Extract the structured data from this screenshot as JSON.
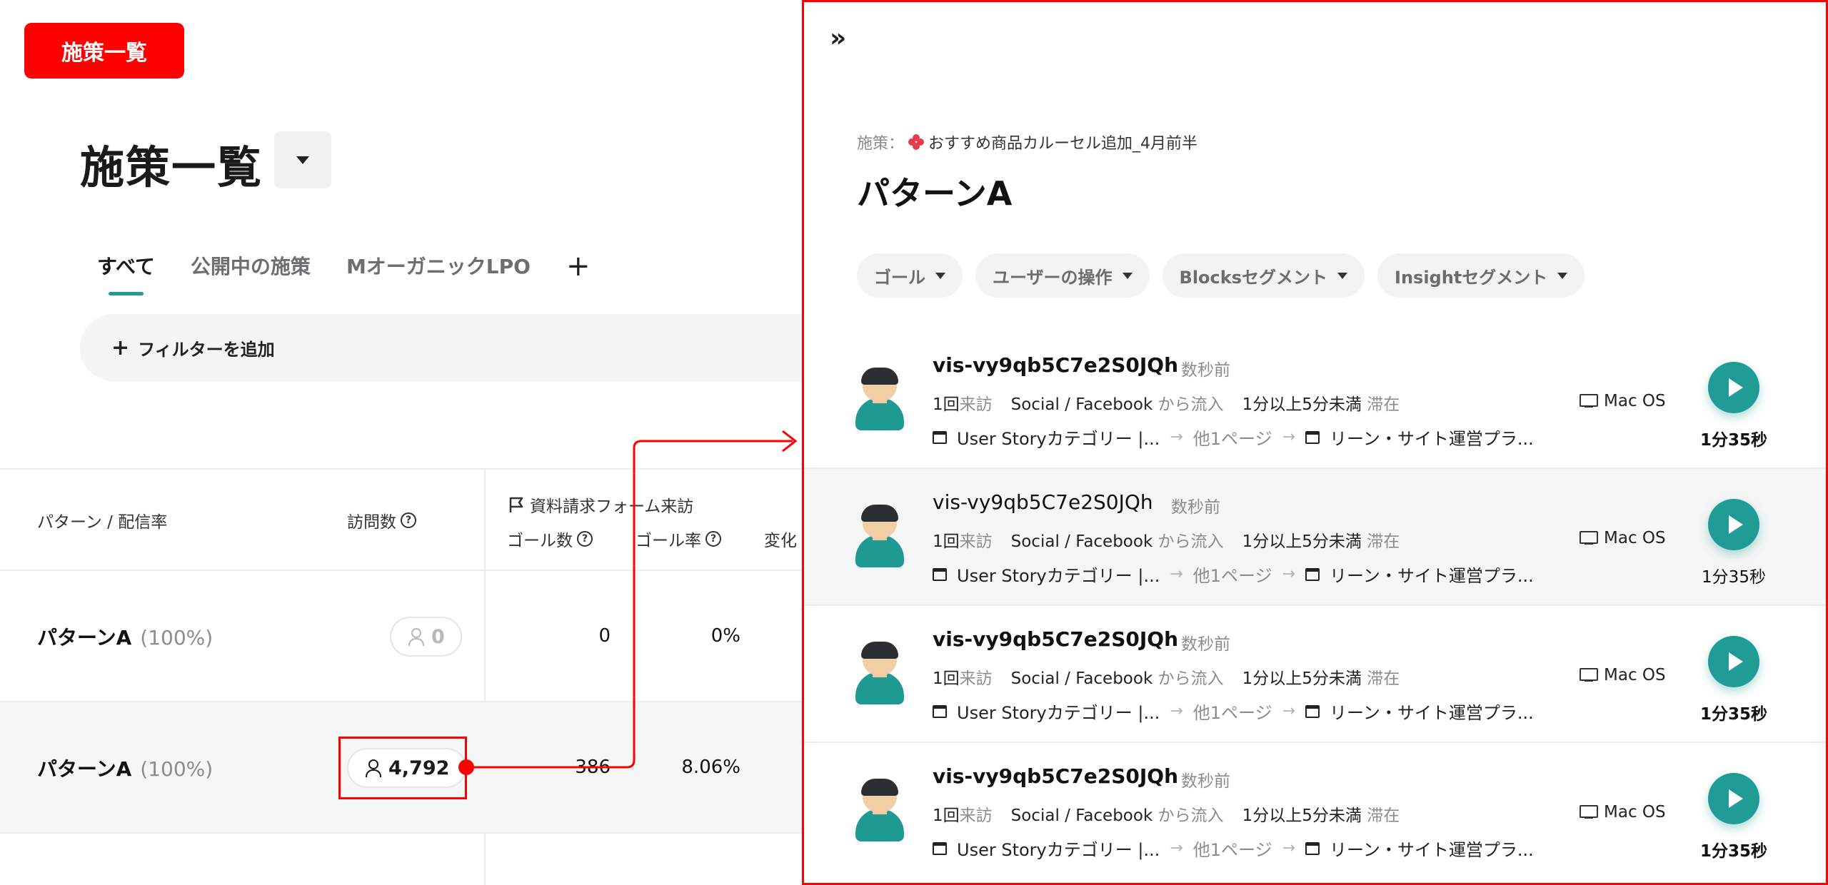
{
  "badge": "施策一覧",
  "page": {
    "title": "施策一覧"
  },
  "tabs": [
    "すべて",
    "公開中の施策",
    "MオーガニックLPO",
    "+"
  ],
  "filter": {
    "plus": "+",
    "label": "フィルターを追加"
  },
  "table": {
    "headers": {
      "pattern": "パターン / 配信率",
      "visits": "訪問数",
      "goal_group": "資料請求フォーム来訪",
      "goal_count": "ゴール数",
      "goal_rate": "ゴール率",
      "change": "変化"
    },
    "rows": [
      {
        "name": "パターンA",
        "pct": "(100%)",
        "visits": "0",
        "goal_count": "0",
        "goal_rate": "0%"
      },
      {
        "name": "パターンA",
        "pct": "(100%)",
        "visits": "4,792",
        "goal_count": "386",
        "goal_rate": "8.06%"
      }
    ]
  },
  "panel": {
    "collapse_icon": "»",
    "campaign_label": "施策：",
    "campaign_name": "おすすめ商品カルーセル追加_4月前半",
    "title": "パターンA",
    "chips": [
      "ゴール",
      "ユーザーの操作",
      "Blocksセグメント",
      "Insightセグメント"
    ],
    "sessions": [
      {
        "id": "vis-vy9qb5C7e2S0JQh",
        "ago": "数秒前",
        "visit_count": "1回",
        "visit_suffix": "来訪",
        "source": "Social / Facebook",
        "source_suffix": "から流入",
        "stay": "1分以上5分未満",
        "stay_suffix": "滞在",
        "page_from": "User Storyカテゴリー |...",
        "other_pages": "他1ページ",
        "page_to": "リーン・サイト運営プラ...",
        "os": "Mac OS",
        "duration": "1分35秒"
      },
      {
        "id": "vis-vy9qb5C7e2S0JQh",
        "ago": "数秒前",
        "visit_count": "1回",
        "visit_suffix": "来訪",
        "source": "Social / Facebook",
        "source_suffix": "から流入",
        "stay": "1分以上5分未満",
        "stay_suffix": "滞在",
        "page_from": "User Storyカテゴリー |...",
        "other_pages": "他1ページ",
        "page_to": "リーン・サイト運営プラ...",
        "os": "Mac OS",
        "duration": "1分35秒"
      },
      {
        "id": "vis-vy9qb5C7e2S0JQh",
        "ago": "数秒前",
        "visit_count": "1回",
        "visit_suffix": "来訪",
        "source": "Social / Facebook",
        "source_suffix": "から流入",
        "stay": "1分以上5分未満",
        "stay_suffix": "滞在",
        "page_from": "User Storyカテゴリー |...",
        "other_pages": "他1ページ",
        "page_to": "リーン・サイト運営プラ...",
        "os": "Mac OS",
        "duration": "1分35秒"
      },
      {
        "id": "vis-vy9qb5C7e2S0JQh",
        "ago": "数秒前",
        "visit_count": "1回",
        "visit_suffix": "来訪",
        "source": "Social / Facebook",
        "source_suffix": "から流入",
        "stay": "1分以上5分未満",
        "stay_suffix": "滞在",
        "page_from": "User Storyカテゴリー |...",
        "other_pages": "他1ページ",
        "page_to": "リーン・サイト運営プラ...",
        "os": "Mac OS",
        "duration": "1分35秒"
      }
    ]
  },
  "colors": {
    "accent": "#1e9c95",
    "highlight": "#ff0000"
  }
}
